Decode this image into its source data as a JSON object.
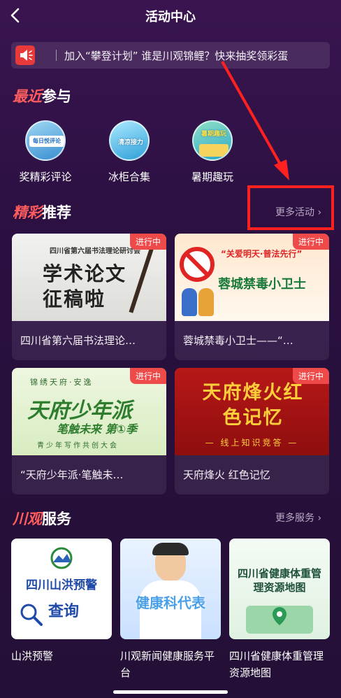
{
  "header": {
    "title": "活动中心"
  },
  "notice": {
    "text": "加入“攀登计划” 谁是川观锦鲤？快来抽奖领彩蛋"
  },
  "recent": {
    "accent": "最近",
    "rest": "参与",
    "items": [
      {
        "label": "奖精彩评论",
        "thumb_text": "每日悦评论"
      },
      {
        "label": "冰柜合集",
        "thumb_text": "清凉接力"
      },
      {
        "label": "暑期趣玩",
        "thumb_text": "暑期趣玩"
      }
    ]
  },
  "featured": {
    "accent": "精彩",
    "rest": "推荐",
    "more": "更多活动 ›",
    "cards": [
      {
        "badge": "进行中",
        "caption": "四川省第六届书法理论…",
        "banner_top": "四川省第六届书法理论研讨会",
        "banner_main": "学术论文征稿啦"
      },
      {
        "badge": "进行中",
        "caption": "蓉城禁毒小卫士——“…",
        "banner_top": "“关爱明天·普法先行”",
        "banner_main": "蓉城禁毒小卫士"
      },
      {
        "badge": "进行中",
        "caption": "“天府少年派·笔触未…",
        "banner_top": "锦绣天府·安逸",
        "banner_main": "天府少年派",
        "banner_sub": "笔触未来 第①季",
        "banner_foot": "青少年写作共创大会"
      },
      {
        "badge": "进行中",
        "caption": "天府烽火 红色记忆",
        "banner_main": "天府烽火红色记忆",
        "banner_sub": "— 线上知识竞答 —"
      }
    ]
  },
  "services": {
    "accent": "川观",
    "rest": "服务",
    "more": "更多服务 ›",
    "items": [
      {
        "label": "山洪预警",
        "thumb_text": "四川山洪预警",
        "thumb_sub": "查询"
      },
      {
        "label": "川观新闻健康服务平台",
        "thumb_text": "健康科代表"
      },
      {
        "label": "四川省健康体重管理资源地图",
        "thumb_text": "四川省健康体重管理资源地图"
      }
    ]
  },
  "colors": {
    "accent": "#ff5d5d",
    "badge": "#ef4a4a",
    "annotation": "#ff2020"
  }
}
